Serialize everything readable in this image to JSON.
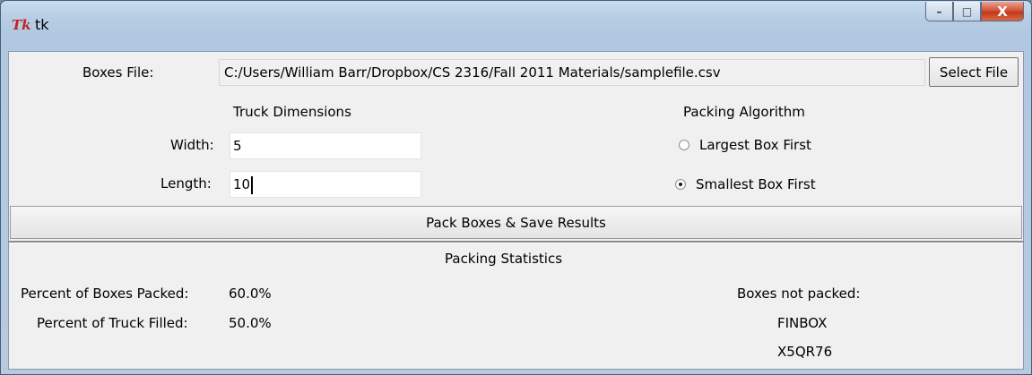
{
  "window": {
    "title": "tk",
    "app_icon": "Tk",
    "controls": {
      "minimize": "–",
      "maximize": "□",
      "close": "X"
    }
  },
  "file_row": {
    "label": "Boxes File:",
    "path": "C:/Users/William Barr/Dropbox/CS 2316/Fall 2011 Materials/samplefile.csv",
    "button": "Select File"
  },
  "truck": {
    "heading": "Truck Dimensions",
    "width_label": "Width:",
    "width_value": "5",
    "length_label": "Length:",
    "length_value": "10"
  },
  "algorithm": {
    "heading": "Packing Algorithm",
    "options": [
      "Largest Box First",
      "Smallest Box First"
    ],
    "selected": "Smallest Box First"
  },
  "pack_button": "Pack Boxes & Save Results",
  "stats": {
    "heading": "Packing Statistics",
    "boxes_packed_label": "Percent of Boxes Packed:",
    "boxes_packed_value": "60.0%",
    "truck_filled_label": "Percent of Truck Filled:",
    "truck_filled_value": "50.0%",
    "not_packed_label": "Boxes not packed:",
    "not_packed": [
      "FINBOX",
      "X5QR76"
    ]
  }
}
